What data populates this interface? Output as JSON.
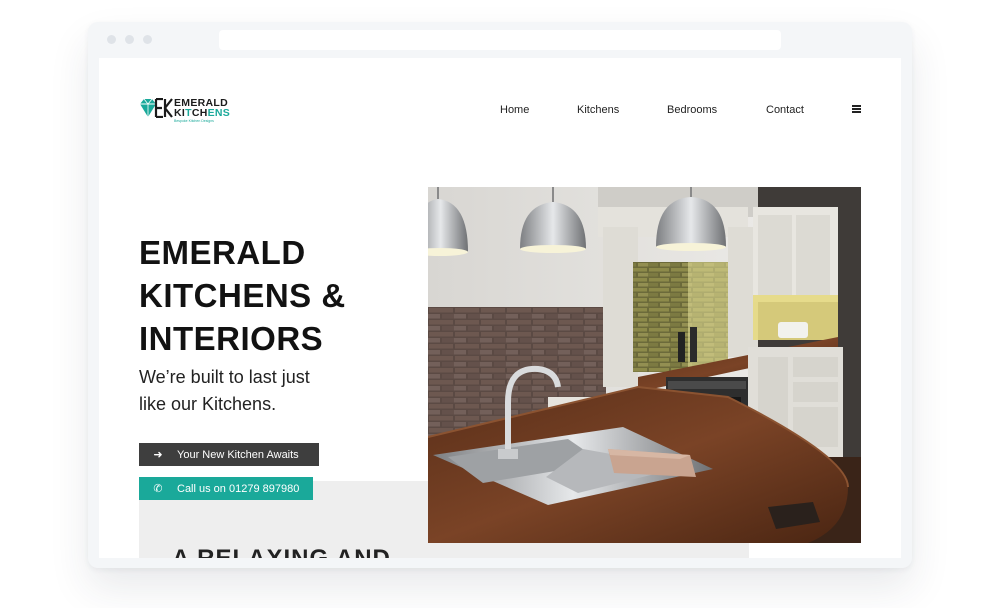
{
  "brand": {
    "line1": "EMERALD",
    "line2_a": "KI",
    "line2_b": "T",
    "line2_c": "CH",
    "line2_d": "ENS",
    "tagline": "Bespoke Kitchen Designs",
    "accent_color": "#1aa99a"
  },
  "nav": {
    "items": [
      {
        "label": "Home"
      },
      {
        "label": "Kitchens"
      },
      {
        "label": "Bedrooms"
      },
      {
        "label": "Contact"
      }
    ],
    "menu_icon": "hamburger-menu-icon"
  },
  "hero": {
    "title_lines": [
      "EMERALD",
      "KITCHENS &",
      "INTERIORS"
    ],
    "subtitle_lines": [
      "We’re built to last just",
      "like our Kitchens."
    ],
    "primary_button": {
      "label": "Your New Kitchen Awaits",
      "icon": "arrow-right-icon"
    },
    "call_button": {
      "label": "Call us on 01279 897980",
      "icon": "phone-icon"
    },
    "image": "kitchen-photo"
  },
  "section": {
    "heading": "A RELAXING AND"
  }
}
